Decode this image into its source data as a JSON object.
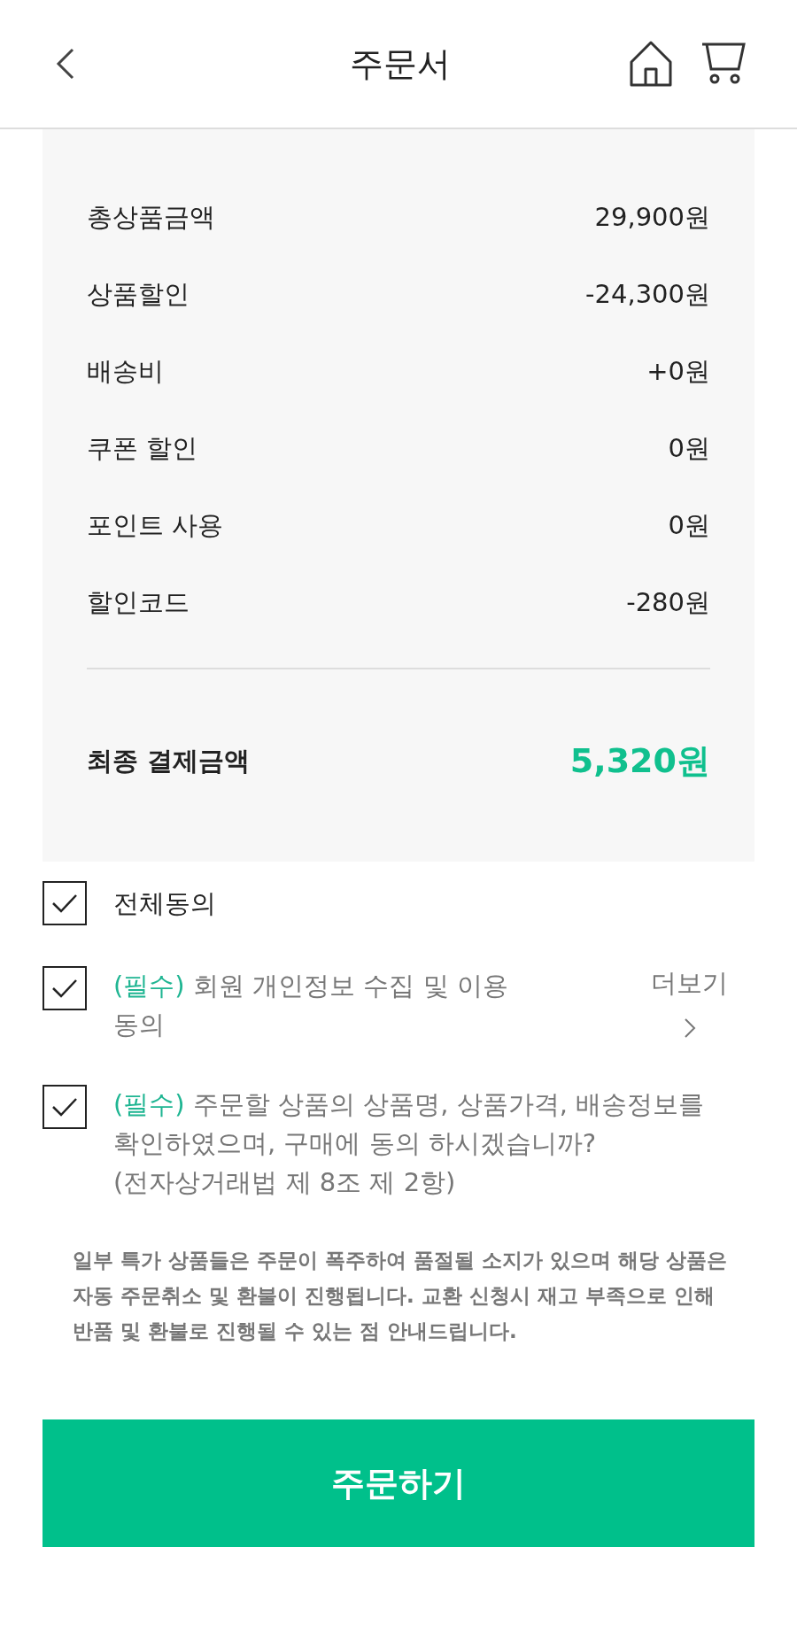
{
  "header": {
    "title": "주문서"
  },
  "summary": {
    "rows": [
      {
        "label": "총상품금액",
        "value": "29,900원"
      },
      {
        "label": "상품할인",
        "value": "-24,300원"
      },
      {
        "label": "배송비",
        "value": "+0원"
      },
      {
        "label": "쿠폰 할인",
        "value": "0원"
      },
      {
        "label": "포인트 사용",
        "value": "0원"
      },
      {
        "label": "할인코드",
        "value": "-280원"
      }
    ],
    "total": {
      "label": "최종 결제금액",
      "value": "5,320원"
    }
  },
  "agreements": [
    {
      "kind": "all",
      "checked": true,
      "text": "전체동의"
    },
    {
      "kind": "required",
      "checked": true,
      "tag": "(필수)",
      "text": "회원 개인정보 수집 및 이용 동의",
      "more": "더보기"
    },
    {
      "kind": "required",
      "checked": true,
      "tag": "(필수)",
      "text": "주문할 상품의 상품명, 상품가격, 배송정보를 확인하였으며, 구매에 동의 하시겠습니까?\n(전자상거래법 제 8조 제 2항)"
    }
  ],
  "notice": "일부 특가 상품들은 주문이 폭주하여 품절될 소지가 있으며 해당 상품은 자동 주문취소 및 환불이 진행됩니다. 교환 신청시 재고 부족으로 인해 반품 및 환불로 진행될 수 있는 점 안내드립니다.",
  "order_button": "주문하기"
}
